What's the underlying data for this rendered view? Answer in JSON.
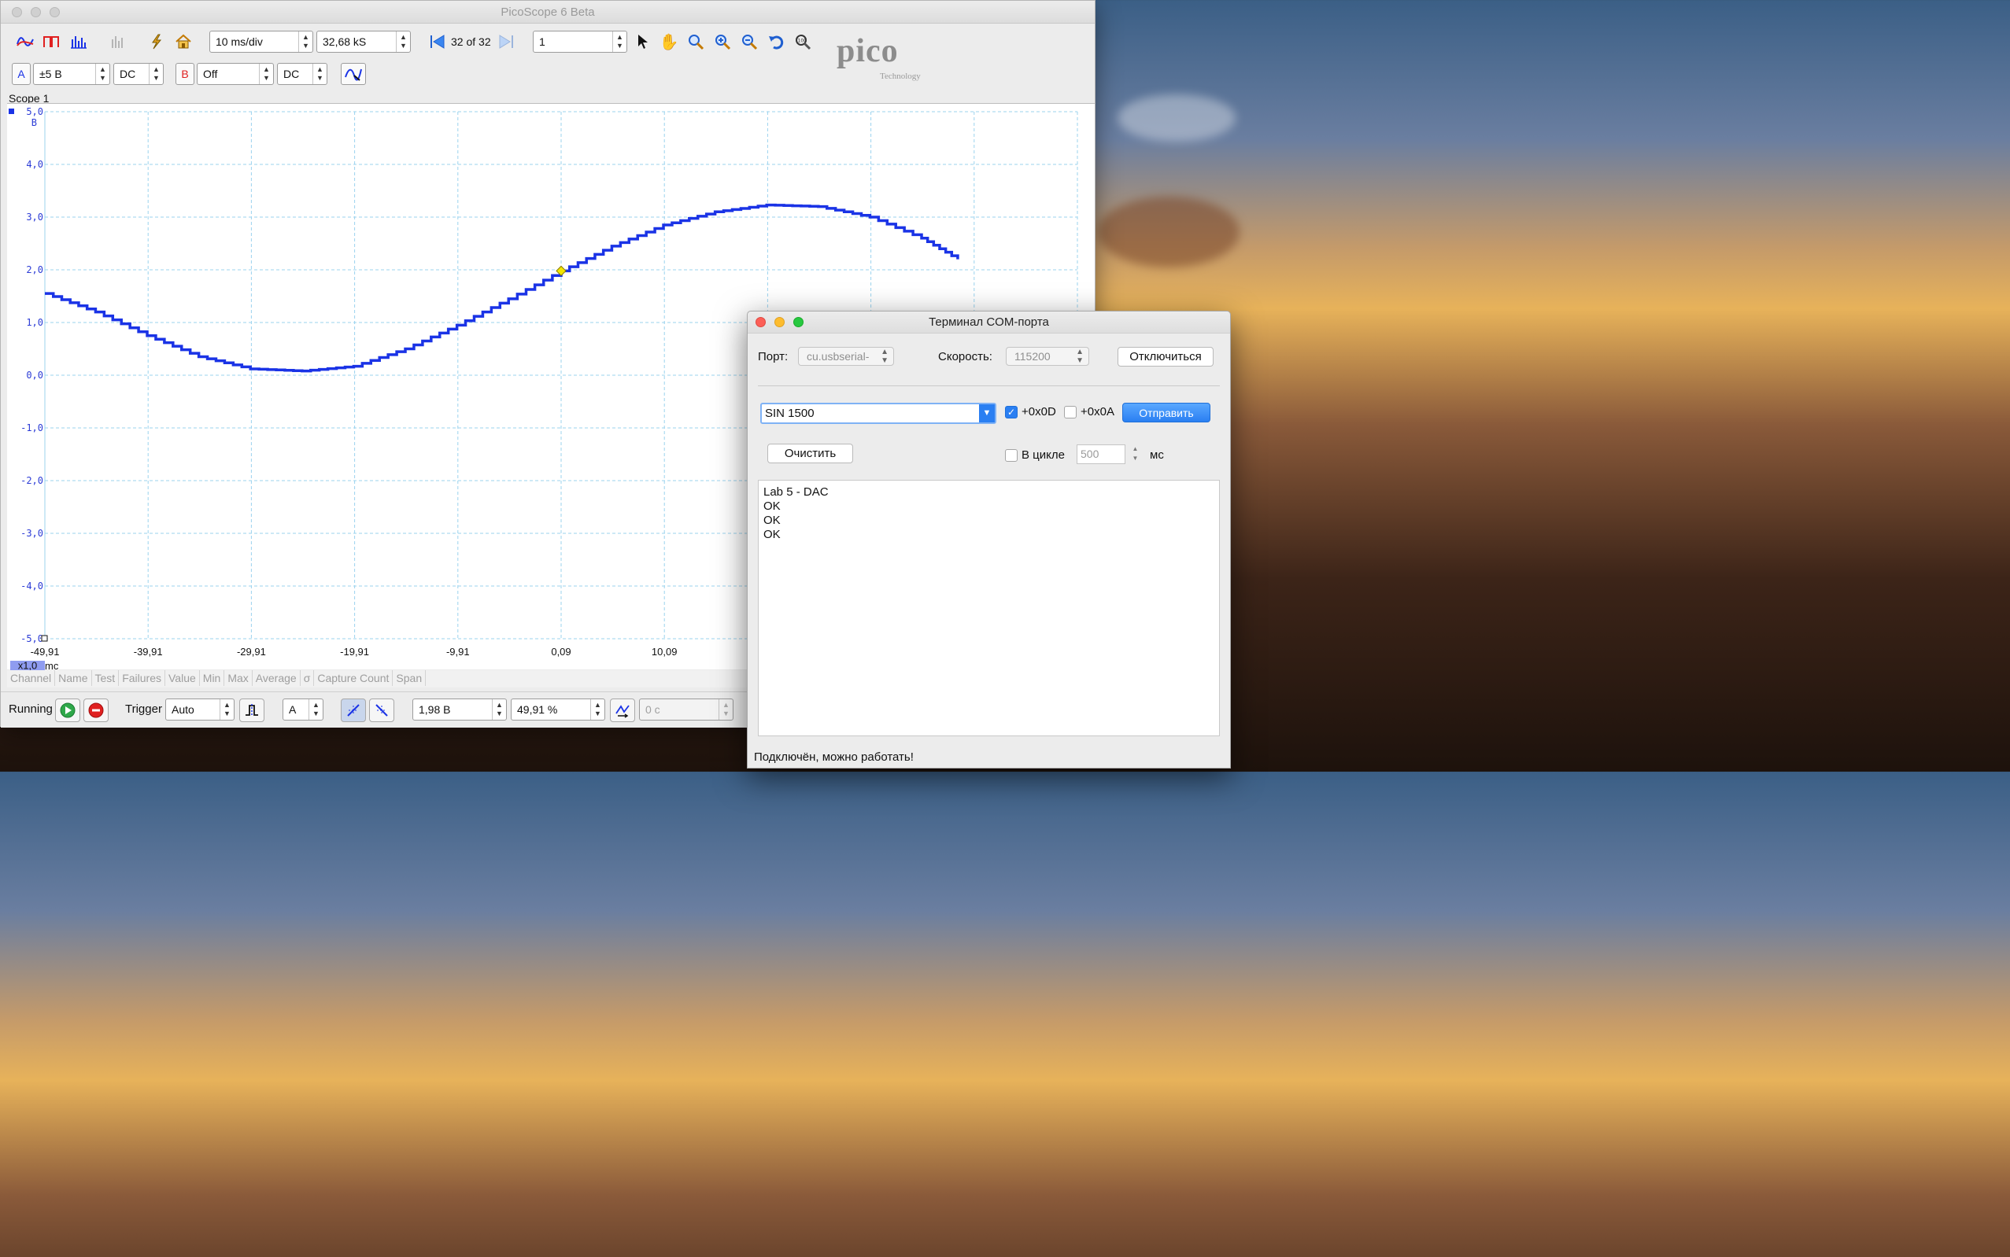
{
  "pico": {
    "title": "PicoScope 6 Beta",
    "timebase": "10 ms/div",
    "samples": "32,68 kS",
    "buffer_nav": "32 of 32",
    "buffer_index": "1",
    "logo_word": "pico",
    "logo_sub": "Technology",
    "channel_a": {
      "name": "A",
      "range": "±5 B",
      "coupling": "DC",
      "color": "#1a33e6"
    },
    "channel_b": {
      "name": "B",
      "range": "Off",
      "coupling": "DC",
      "color": "#e02020"
    },
    "scope_tab": "Scope 1",
    "y_ticks": [
      "5,0",
      "4,0",
      "3,0",
      "2,0",
      "1,0",
      "0,0",
      "-1,0",
      "-2,0",
      "-3,0",
      "-4,0",
      "-5,0"
    ],
    "y_unit": "B",
    "x_ticks": [
      "-49,91",
      "-39,91",
      "-29,91",
      "-19,91",
      "-9,91",
      "0,09",
      "10,09"
    ],
    "x_zoom": "x1,0",
    "x_unit": "mc",
    "measure_columns": [
      "Channel",
      "Name",
      "Test",
      "Failures",
      "Value",
      "Min",
      "Max",
      "Average",
      "σ",
      "Capture Count",
      "Span"
    ],
    "status": "Running",
    "trigger_label": "Trigger",
    "trigger_mode": "Auto",
    "trigger_channel": "A",
    "trigger_level": "1,98 B",
    "trigger_pretrigger": "49,91 %",
    "trigger_delay": "0 c",
    "trace_color": "#1a33e6",
    "trigger_marker_color": "#f2e600"
  },
  "chart_data": {
    "type": "line",
    "title": "",
    "xlabel": "mc",
    "ylabel": "B",
    "xlim": [
      -49.91,
      50.09
    ],
    "ylim": [
      -5.0,
      5.0
    ],
    "grid": true,
    "series": [
      {
        "x": [
          -49.91,
          -45,
          -40,
          -35,
          -30,
          -25,
          -20,
          -15,
          -10,
          -5,
          0.09,
          5,
          10,
          15,
          20,
          25,
          30,
          35,
          38.5
        ],
        "y": [
          1.55,
          1.2,
          0.75,
          0.35,
          0.12,
          0.08,
          0.17,
          0.5,
          0.95,
          1.45,
          1.98,
          2.45,
          2.85,
          3.1,
          3.23,
          3.2,
          3.0,
          2.6,
          2.2
        ]
      }
    ],
    "trigger": {
      "x": 0.09,
      "y": 1.98
    }
  },
  "terminal": {
    "title": "Терминал COM-порта",
    "port_label": "Порт:",
    "port_value": "cu.usbserial-",
    "speed_label": "Скорость:",
    "speed_value": "115200",
    "disconnect_button": "Отключиться",
    "command_value": "SIN 1500",
    "cr_label": "+0x0D",
    "cr_checked": true,
    "lf_label": "+0x0A",
    "lf_checked": false,
    "send_button": "Отправить",
    "clear_button": "Очистить",
    "loop_label": "В цикле",
    "loop_checked": false,
    "loop_value": "500",
    "loop_unit": "мс",
    "output_lines": [
      "Lab 5 - DAC",
      "OK",
      "OK",
      "OK"
    ],
    "status": "Подключён, можно работать!"
  }
}
